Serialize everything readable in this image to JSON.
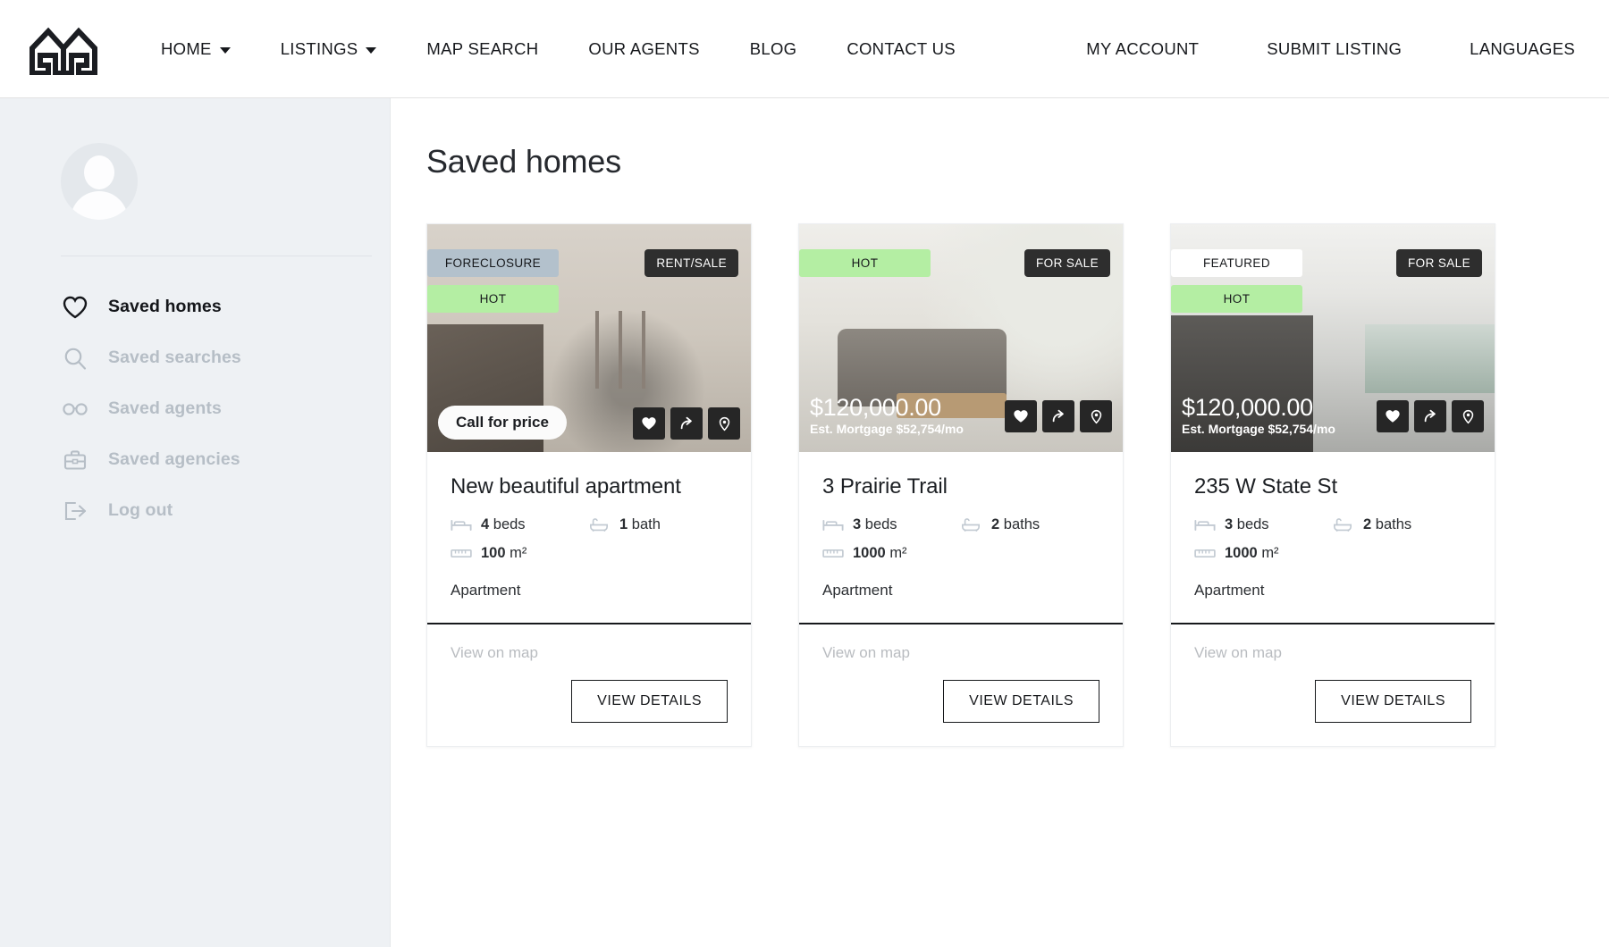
{
  "nav": {
    "logo_icon": "double-house-logo",
    "left_items": [
      {
        "label": "HOME",
        "has_caret": true
      },
      {
        "label": "LISTINGS",
        "has_caret": true
      },
      {
        "label": "MAP SEARCH",
        "has_caret": false
      },
      {
        "label": "OUR AGENTS",
        "has_caret": false
      },
      {
        "label": "BLOG",
        "has_caret": false
      },
      {
        "label": "CONTACT US",
        "has_caret": false
      }
    ],
    "right_items": [
      {
        "label": "MY ACCOUNT"
      },
      {
        "label": "SUBMIT LISTING"
      },
      {
        "label": "LANGUAGES"
      }
    ]
  },
  "sidebar": {
    "avatar_icon": "user-avatar-placeholder",
    "items": [
      {
        "label": "Saved homes",
        "icon": "heart-icon",
        "active": true
      },
      {
        "label": "Saved searches",
        "icon": "search-icon",
        "active": false
      },
      {
        "label": "Saved agents",
        "icon": "glasses-icon",
        "active": false
      },
      {
        "label": "Saved agencies",
        "icon": "briefcase-icon",
        "active": false
      },
      {
        "label": "Log out",
        "icon": "logout-icon",
        "active": false
      }
    ]
  },
  "main": {
    "title": "Saved homes",
    "view_map_label": "View on map",
    "view_details_label": "VIEW DETAILS",
    "cards": [
      {
        "photo_class": "photo-1",
        "badges_left": [
          {
            "text": "FORECLOSURE",
            "style": "foreclosure"
          },
          {
            "text": "HOT",
            "style": "hot"
          }
        ],
        "badge_right": "RENT/SALE",
        "price_mode": "pill",
        "price_pill": "Call for price",
        "price_amount": "",
        "price_mortgage": "",
        "title": "New beautiful apartment",
        "beds": "4",
        "beds_label": "beds",
        "baths": "1",
        "baths_label": "bath",
        "area": "100",
        "area_unit": "m²",
        "property_type": "Apartment"
      },
      {
        "photo_class": "photo-2",
        "badges_left": [
          {
            "text": "HOT",
            "style": "hot"
          }
        ],
        "badge_right": "FOR SALE",
        "price_mode": "overlay",
        "price_pill": "",
        "price_amount": "$120,000.00",
        "price_mortgage": "Est. Mortgage $52,754/mo",
        "title": "3 Prairie Trail",
        "beds": "3",
        "beds_label": "beds",
        "baths": "2",
        "baths_label": "baths",
        "area": "1000",
        "area_unit": "m²",
        "property_type": "Apartment"
      },
      {
        "photo_class": "photo-3",
        "badges_left": [
          {
            "text": "FEATURED",
            "style": "featured"
          },
          {
            "text": "HOT",
            "style": "hot"
          }
        ],
        "badge_right": "FOR SALE",
        "price_mode": "overlay",
        "price_pill": "",
        "price_amount": "$120,000.00",
        "price_mortgage": "Est. Mortgage $52,754/mo",
        "title": "235 W State St",
        "beds": "3",
        "beds_label": "beds",
        "baths": "2",
        "baths_label": "baths",
        "area": "1000",
        "area_unit": "m²",
        "property_type": "Apartment"
      }
    ],
    "action_icons": [
      "heart-icon",
      "share-arrow-icon",
      "map-pin-icon"
    ]
  },
  "colors": {
    "sidebar_bg": "#eef1f4",
    "hot_badge": "#b4eea3",
    "foreclosure_badge": "#b3c1cc",
    "dark_badge": "#2e2e2e",
    "text": "#17191c",
    "muted": "#b6bec6"
  }
}
